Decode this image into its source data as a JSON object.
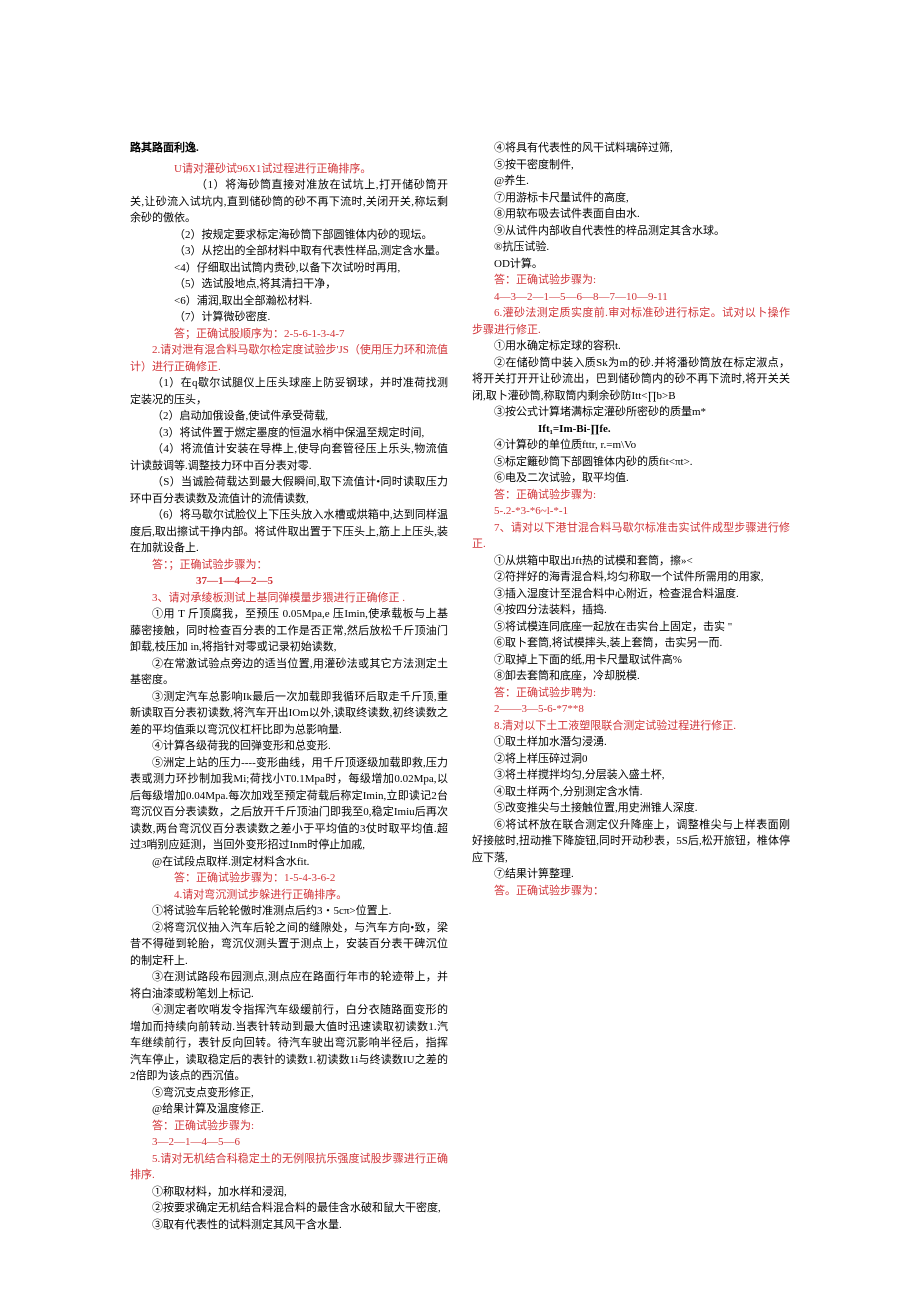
{
  "title": "路其路面利逸.",
  "q1_title": "U请对灌砂试96X1试过程进行正确排序。",
  "q1_1": "（1）将海砂筒直接对准放在试坑上,打开储砂筒开关,让砂流入试坑内,直到储砂筒的砂不再下流时,关闭开关,称坛剩余砂的傲依。",
  "q1_2": "（2）按规定要求标定海砂筒下部圆锥体内砂的现坛。",
  "q1_3": "（3）从挖出的全部材料中取有代表性样品,测定含水量。",
  "q1_4": "<4）仔细取出试筒内贵砂,以备下次试吩时再用,",
  "q1_5": "（5）选试股地点,将其清扫干净，",
  "q1_6": "<6）浦润,取出全部瀚松材料.",
  "q1_7": "（7）计算微砂密度.",
  "q1_ans": "答；正确试股顺序为：2-5-6-1-3-4-7",
  "q2_title": "2.请对泄有混合料马歇尔检定度试验步'JS（使用压力环和流值计）进行正确修正.",
  "q2_1": "（1）在q歇尔试腿仪上压头球座上防妥钢球，并时准荷找测定装况的压头，",
  "q2_2": "（2）启动加俄设备,使试件承受荷载,",
  "q2_3": "（3）将试件置于燃定墨度的恒温水梢中保温至规定时间,",
  "q2_4": "（4）将流值计安装在导榫上,使导向套管径压上乐头,物流值计读鼓调等.调整技力环中百分表对零.",
  "q2_5": "（S）当诚脸荷载达到最大假瞬间,取下流值计•同时读取压力环中百分表读数及流值计的流倩读数,",
  "q2_6": "（6）将马歇尔试脸仪上下压头放入水槽或烘箱中,达到同样温度后,取出擦试干挣内部。将试件取出置于下压头上,筋上上压头,装在加就设备上.",
  "q2_ans_label": "答：；正确试验步骤为：",
  "q2_ans": "37—1—4—2—5",
  "q3_title": "3、请对承绫板测试上基同弹模量步猥进行正确修正 .",
  "q3_1": "①用 T 斤顶腐我，至预压 0.05Mpa,e 压Imin,使承载板与上基藤密接触，同时检查百分表的工作是否正常,然后放松千斤顶油门卸载,枝压加 in,将指针对零或记录初始读数,",
  "q3_2": "②在常激试验点旁边的适当位置,用灌砂法或其它方法测定土基密度。",
  "q3_3": "③测定汽车总影响Ik最后一次加载即我循环后取走千斤顶,重新读取百分表初读数,将汽车开出IOm以外,读取终读数,初终读数之差的平均值乘以弯沉仪杠杆比即为总影响量.",
  "q3_4": "④计算各级荷我的回弹变形和总变形.",
  "q3_5": "⑤洲定上站的压力----变形曲线，用千斤顶逐级加载即救,压力表或测力环抄制加我Mi;荷找小T0.1Mpa时，每级增加0.02Mpa,以后每级增加0.04Mpa.每次加戏至预定荷载后称定Imin,立即读记2台弯沉仪百分表读数，之后放开千斤顶油门即我至0,稳定Imiu后再次读数,两台弯沉仪百分表读数之差小于平均值的3仗时取平均值.超过3哨别应延测，当回外变形招过Inm时停止加戚,",
  "q3_6": "@在试段点取样.测定材料含水fit.",
  "q3_ans": "答：正确试验步骤为：1-5-4-3-6-2",
  "q4_title": "4.请对弯沉测试步躲进行正确排序。",
  "q4_1": "①将试验车后轮轮傲时准测点后约3・5cπ>位置上.",
  "q4_2": "②将弯沉仪抽入汽车后轮之间的缝隙处，与汽车方向•致，梁昔不得碰到轮胎，弯沉仪测头置于测点上，安装百分表干碑沉位的制定秆上.",
  "q4_3": "③在测试路段布园测点,测点应在路面行年市的轮迹带上，并将白油漆或粉笔划上标记.",
  "q4_4": "④测定者吹哨发令指挥汽车级缓前行，白分衣随路面变形的增加而持续向前转动.当表针转动到最大值时迅速读取初读数1.汽车继续前行，表针反向回转。待汽车驶出弯沉影响半径后，指挥汽车停止，读取稳定后的表针的读数1.初读数1i与终读数IU之差的2倍即为该点的西沉值。",
  "q4_5": "⑤弯沉支点变形修正,",
  "q4_6": "@给果计算及温度修正.",
  "q4_ans_label": "答：正确试验步骤为:",
  "q4_ans": "3—2—1—4—5—6",
  "q5_title": "5.请对无机结合科稳定土的无例限抗乐强度试股步骤进行正确排序.",
  "q5_1": "①称取材料，加水样和浸润,",
  "q5_2": "②按要求确定无机结合料混合料的最佳含水破和鼠大干密度,",
  "q5_3": "③取有代表性的试料测定其风干含水量.",
  "q5_4": "④将具有代表性的风干试料璃碎过筛,",
  "q5_5": "⑤按干密度制件,",
  "q5_6": "@养生.",
  "q5_7": "⑦用游标卡尺量试件的高度,",
  "q5_8": "⑧用软布吸去试件表面自由水.",
  "q5_9": "⑨从试件内部收自代表性的梓品测定其含水球。",
  "q5_10": "®抗压试验.",
  "q5_11": "OD计算。",
  "q5_ans_label": "答：正确试验步骤为:",
  "q5_ans": "4—3—2—1—5—6—8—7—10—9-11",
  "q6_title": "6.灌砂法测定质实度前.审对标准砂进行标定。试对以卜操作步骤进行修正.",
  "q6_1": "①用水确定标定球的容积t.",
  "q6_2": "②在储砂筒中装入质Sk为m的砂.并将潘砂筒放在标定淑点，将开关打开开让砂流出，巴到储砂筒内的砂不再下流时,将开关关闭,取卜灌砂筒,称取筒内剩余砂防Itt<∏b>B",
  "q6_3": "③按公式计算堵满标定灌砂所密砂的质量m*",
  "q6_formula": "Ift₁=Im-Bi-∏fe.",
  "q6_4": "④计算砂的单位质fttr,        r.=m\\Vo",
  "q6_5": "⑤标定籬砂筒下部圆锥体内砂的质fit<πt>.",
  "q6_6": "⑥电及二次试验，取平均值.",
  "q6_ans_label": "答：正确试验步骤为:",
  "q6_ans": "5-.2-*3-*6~l-*-1",
  "q7_title": "7、请对以下港甘混合料马歇尔标准击实试件成型步骤进行修正.",
  "q7_1": "①从烘箱中取出Jft热的试模和套筒，擦»<",
  "q7_2": "②符拌好的海青混合料,均匀称取一个试件所需用的用家,",
  "q7_3": "③插入湿度计至混合料中心附近，检查混合料温度.",
  "q7_4": "④按四分法装料，插捣.",
  "q7_5": "⑤将试模连同底座一起放在击实台上固定，击实 \"",
  "q7_6": "⑥取卜套筒,将试模摔头,装上套筒，击实另一而.",
  "q7_7": "⑦取掉上下面的纸,用卡尺量取试件高%",
  "q7_8": "⑧卸去套筒和底座，冷却脱模.",
  "q7_ans_label": "答：正确试验步聘为:",
  "q7_ans": "2——3—5-6-*7**8",
  "q8_title": "8.清对以下土工液塑限联合测定试验过程进行修正.",
  "q8_1": "①取土样加水潛匀浸湧.",
  "q8_2": "②将上样压碎过洞0",
  "q8_3": "③将土样搅拌均匀,分层装入盛土杯,",
  "q8_4": "④取土样两个,分别测定含水情.",
  "q8_5": "⑤改变推尖与土接触位置,用史洲锥人深度.",
  "q8_6": "⑥将试杯放在联合测定仪升降座上，调整椎尖与上样表面刚好接舷时,扭动推下降旋钮,同时开动秒表，5S后,松开旅钮，椎体停应下落,",
  "q8_7": "⑦结果计箅整理.",
  "q8_ans": "答。正确试验步骤为："
}
